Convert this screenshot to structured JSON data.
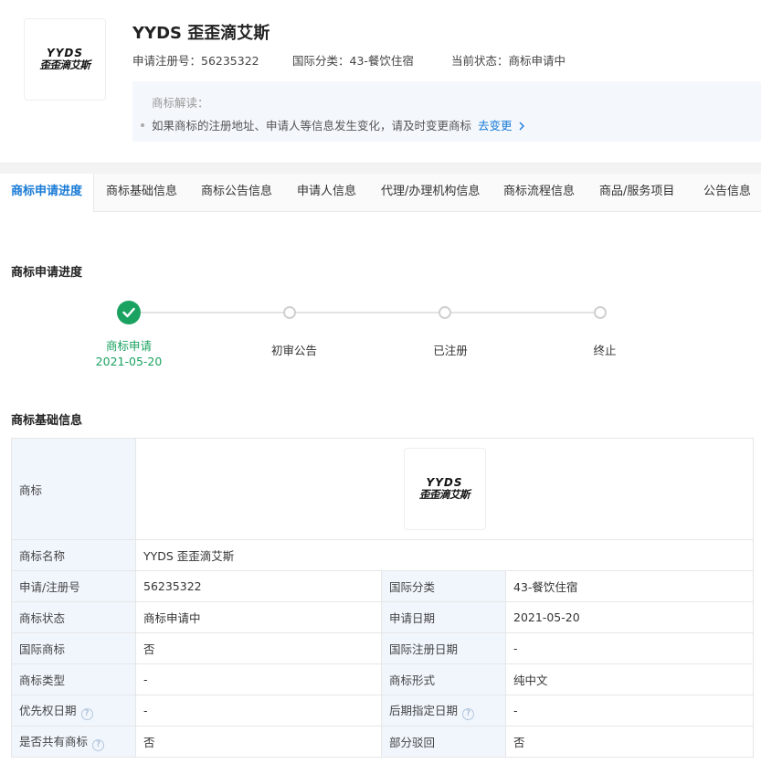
{
  "header": {
    "logo_line1": "YYDS",
    "logo_line2": "歪歪滴艾斯",
    "title": "YYDS 歪歪滴艾斯",
    "reg_no": "申请注册号：56235322",
    "intl_class": "国际分类：43-餐饮住宿",
    "status": "当前状态：商标申请中",
    "tip_title": "商标解读：",
    "tip_text": "如果商标的注册地址、申请人等信息发生变化，请及时变更商标",
    "tip_link": "去变更",
    "tip_link_icon": "chevron-right-icon"
  },
  "tabs": [
    {
      "label": "商标申请进度",
      "active": true
    },
    {
      "label": "商标基础信息"
    },
    {
      "label": "商标公告信息"
    },
    {
      "label": "申请人信息"
    },
    {
      "label": "代理/办理机构信息"
    },
    {
      "label": "商标流程信息"
    },
    {
      "label": "商品/服务项目"
    },
    {
      "label": "公告信息"
    }
  ],
  "progress": {
    "title": "商标申请进度",
    "steps": [
      {
        "label": "商标申请",
        "date": "2021-05-20",
        "done": true
      },
      {
        "label": "初审公告",
        "date": "",
        "done": false
      },
      {
        "label": "已注册",
        "date": "",
        "done": false
      },
      {
        "label": "终止",
        "date": "",
        "done": false
      }
    ],
    "done_color": "#1aa260"
  },
  "basic": {
    "title": "商标基础信息",
    "logo_label": "商标",
    "name_label": "商标名称",
    "name_value": "YYDS 歪歪滴艾斯",
    "rows": [
      {
        "k1": "申请/注册号",
        "v1": "56235322",
        "k2": "国际分类",
        "v2": "43-餐饮住宿"
      },
      {
        "k1": "商标状态",
        "v1": "商标申请中",
        "k2": "申请日期",
        "v2": "2021-05-20"
      },
      {
        "k1": "国际商标",
        "v1": "否",
        "k2": "国际注册日期",
        "v2": "-"
      },
      {
        "k1": "商标类型",
        "v1": "-",
        "k2": "商标形式",
        "v2": "纯中文"
      },
      {
        "k1": "优先权日期",
        "v1": "-",
        "k2": "后期指定日期",
        "v2": "-"
      },
      {
        "k1": "是否共有商标",
        "v1": "否",
        "k2": "部分驳回",
        "v2": "否"
      }
    ],
    "help_icon": "question-circle-icon",
    "help_glyph": "?"
  },
  "colors": {
    "accent": "#1a7bd6",
    "key_bg": "#f1f6fd"
  }
}
